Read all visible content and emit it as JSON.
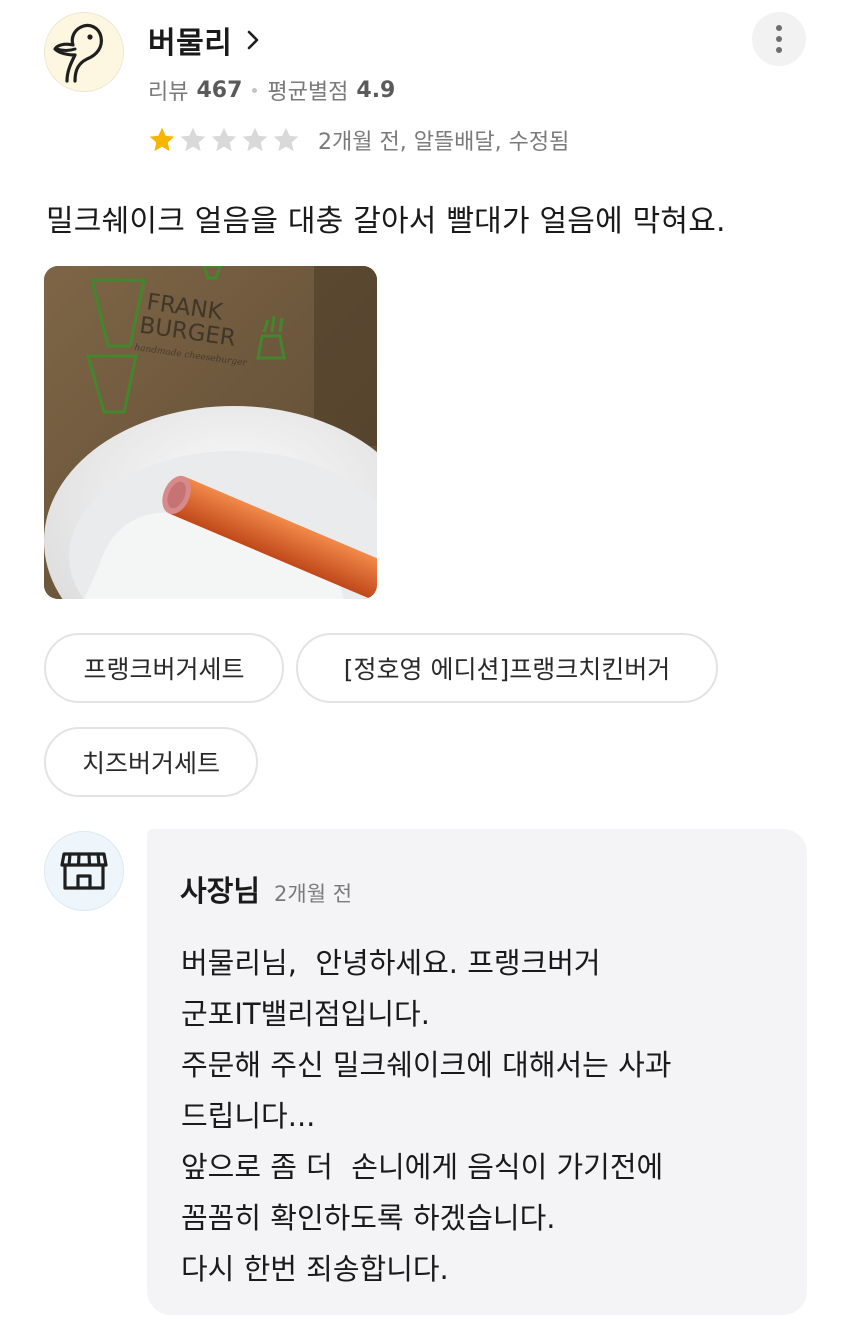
{
  "reviewer": {
    "name": "버물리",
    "stats": {
      "review_label": "리뷰",
      "review_count": "467",
      "avg_label": "평균별점",
      "avg_rating": "4.9"
    }
  },
  "rating": {
    "stars": 1,
    "max_stars": 5,
    "filled_color": "#f7b500",
    "empty_color": "#d9d9d9"
  },
  "review": {
    "meta": "2개월 전, 알뜰배달, 수정됨",
    "text": "밀크쉐이크 얼음을 대충 갈아서 빨대가 얼음에 막혀요.",
    "photo": {
      "bag_lines": [
        "FRANK",
        "BURGER",
        "handmade cheeseburger"
      ]
    }
  },
  "menu_chips": [
    "프랭크버거세트",
    "[정호영 에디션]프랭크치킨버거",
    "치즈버거세트"
  ],
  "owner_reply": {
    "author": "사장님",
    "time": "2개월 전",
    "lines": [
      "버물리님,  안녕하세요. 프랭크버거",
      "군포IT밸리점입니다.",
      "주문해 주신 밀크쉐이크에 대해서는 사과",
      "드립니다...",
      "앞으로 좀 더  손니에게 음식이 가기전에",
      "꼼꼼히 확인하도록 하겠습니다.",
      "다시 한번 죄송합니다."
    ]
  },
  "icons": {
    "avatar": "duck-avatar-icon",
    "chevron": "chevron-right-icon",
    "more": "more-vertical-icon",
    "star": "star-icon",
    "store": "store-icon"
  }
}
